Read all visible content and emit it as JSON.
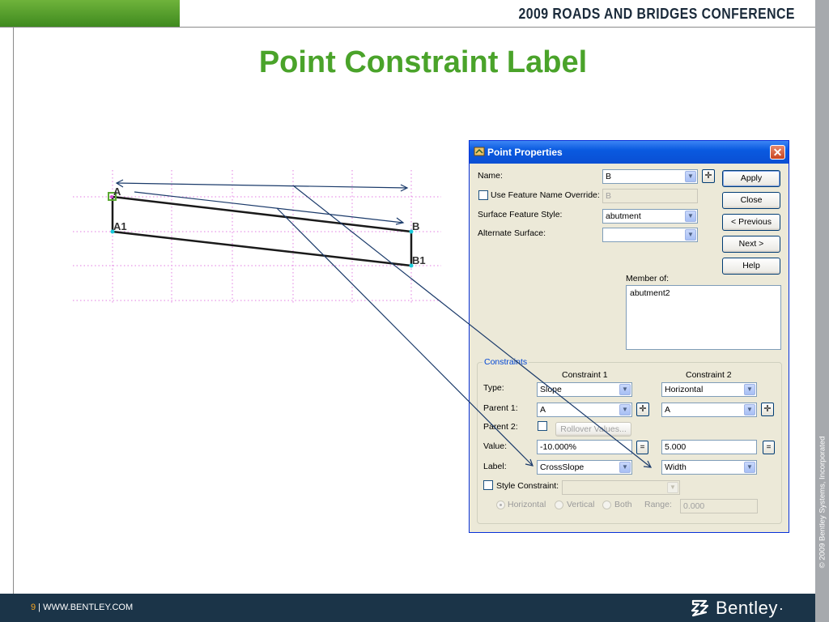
{
  "slide": {
    "conference_title": "2009 ROADS AND BRIDGES CONFERENCE",
    "title": "Point Constraint Label",
    "page_number": "9",
    "footer_separator": " | ",
    "footer_url": "WWW.BENTLEY.COM",
    "logo_text": "Bentley",
    "logo_mark": "·",
    "copyright": "© 2009 Bentley Systems, Incorporated",
    "colors": {
      "accent_green": "#4aa32a",
      "footer_navy": "#1b3448",
      "footer_page": "#f6a623"
    }
  },
  "diagram": {
    "points": [
      "A",
      "B",
      "A1",
      "B1"
    ]
  },
  "dialog": {
    "title": "Point Properties",
    "close_icon": "close-x",
    "name_label": "Name:",
    "name_value": "B",
    "use_override_label": "Use Feature Name Override:",
    "override_value": "B",
    "surface_style_label": "Surface Feature Style:",
    "surface_style_value": "abutment",
    "alternate_surface_label": "Alternate Surface:",
    "alternate_surface_value": "",
    "buttons": {
      "apply": "Apply",
      "close": "Close",
      "previous": "< Previous",
      "next": "Next >",
      "help": "Help"
    },
    "member_of_label": "Member of:",
    "member_of_items": [
      "abutment2"
    ],
    "constraints": {
      "group_label": "Constraints",
      "col1_header": "Constraint 1",
      "col2_header": "Constraint 2",
      "type_label": "Type:",
      "type1": "Slope",
      "type2": "Horizontal",
      "parent1_label": "Parent 1:",
      "parent1_c1": "A",
      "parent1_c2": "A",
      "parent2_label": "Parent 2:",
      "rollover_button": "Rollover Values...",
      "value_label": "Value:",
      "value1": "-10.000%",
      "value2": "5.000",
      "equals": "=",
      "label_label": "Label:",
      "label1": "CrossSlope",
      "label2": "Width",
      "style_constraint_label": "Style Constraint:",
      "radio_horizontal": "Horizontal",
      "radio_vertical": "Vertical",
      "radio_both": "Both",
      "range_label": "Range:",
      "range_value": "0.000"
    }
  }
}
